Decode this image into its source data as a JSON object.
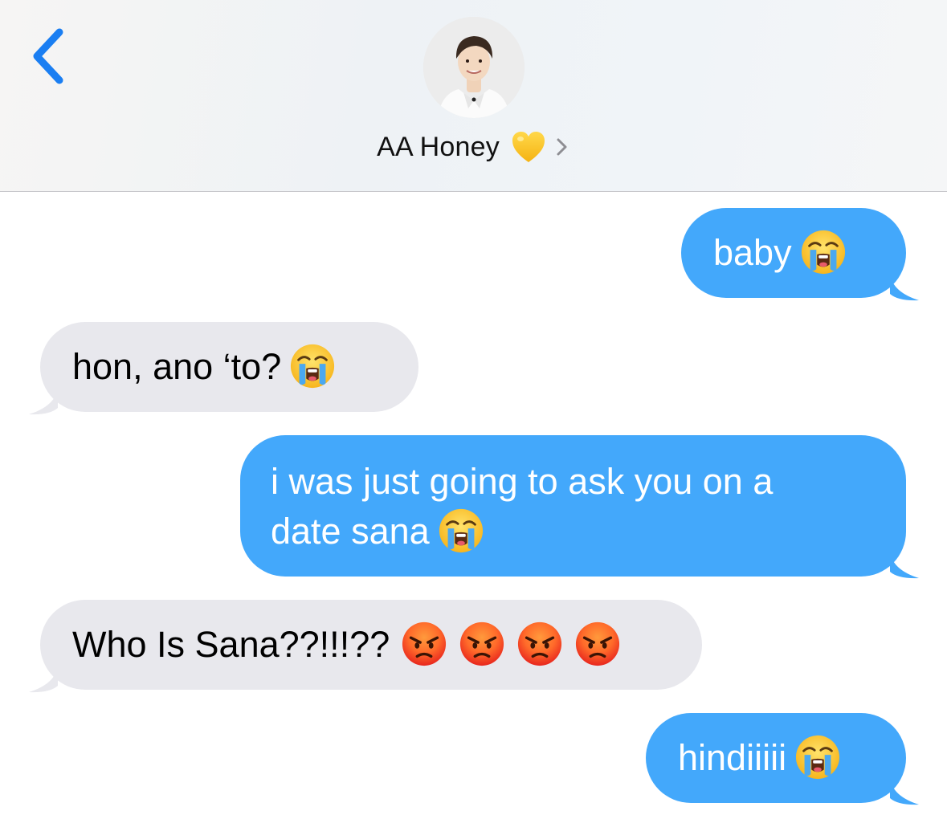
{
  "header": {
    "back_icon": "chevron-left-icon",
    "contact_name": "AA Honey",
    "contact_emoji": "yellow-heart-icon",
    "details_icon": "chevron-right-icon"
  },
  "messages": [
    {
      "direction": "sent",
      "text": "baby",
      "emojis": [
        "loudly-crying-face-icon"
      ]
    },
    {
      "direction": "received",
      "text": "hon, ano ‘to?",
      "emojis": [
        "loudly-crying-face-icon"
      ]
    },
    {
      "direction": "sent",
      "lines": [
        "i was just going to ask you on a",
        "date sana"
      ],
      "emojis": [
        "loudly-crying-face-icon"
      ]
    },
    {
      "direction": "received",
      "text": "Who Is Sana??!!!??",
      "emojis": [
        "pouting-face-icon",
        "pouting-face-icon",
        "pouting-face-icon",
        "pouting-face-icon"
      ]
    },
    {
      "direction": "sent",
      "text": "hindiiiii",
      "emojis": [
        "loudly-crying-face-icon"
      ]
    }
  ],
  "colors": {
    "sent_bubble": "#43a8fb",
    "received_bubble": "#e8e8ed",
    "accent": "#1a7ef2"
  }
}
